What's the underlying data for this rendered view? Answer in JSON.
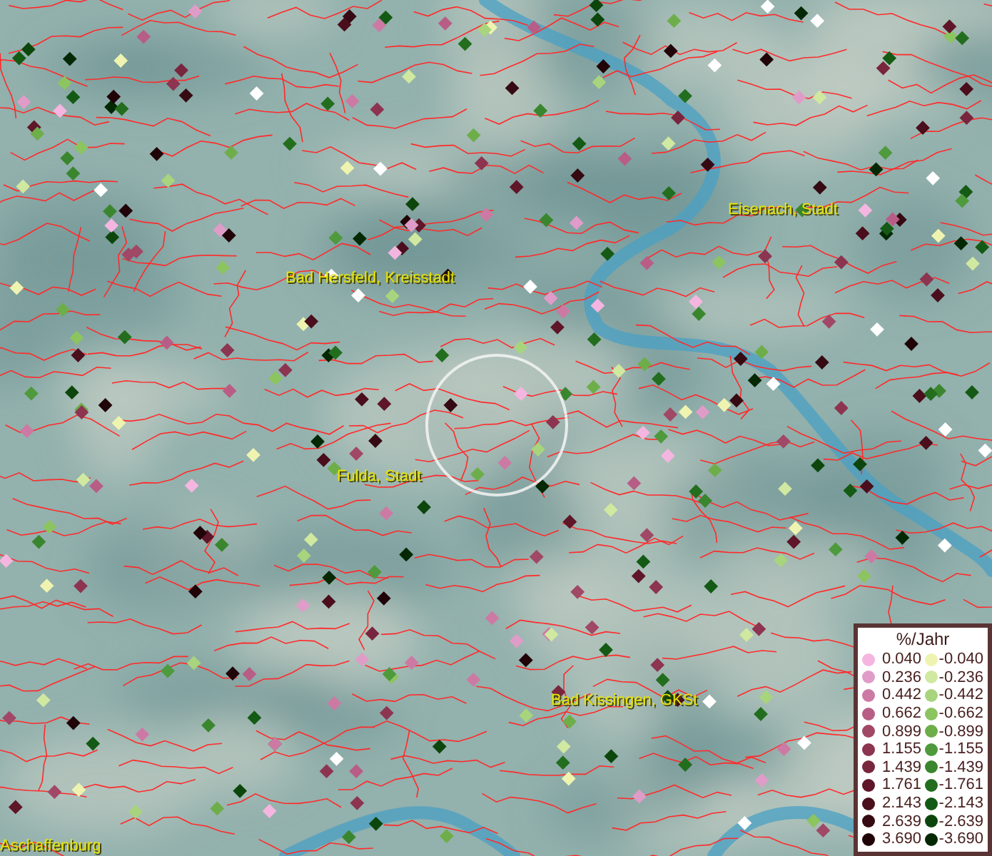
{
  "map": {
    "labels": [
      {
        "text": "Eisenach, Stadt"
      },
      {
        "text": "Bad Hersfeld, Kreisstadt"
      },
      {
        "text": "Fulda, Stadt"
      },
      {
        "text": "Bad Kissingen, GKSt"
      },
      {
        "text": "Aschaffenburg"
      }
    ]
  },
  "legend": {
    "title": "%/Jahr",
    "items": [
      {
        "value": "0.040",
        "color": "#f4b6e0"
      },
      {
        "value": "-0.040",
        "color": "#eef4b0"
      },
      {
        "value": "0.236",
        "color": "#e09cc8"
      },
      {
        "value": "-0.236",
        "color": "#d0e8a0"
      },
      {
        "value": "0.442",
        "color": "#cc7aa4"
      },
      {
        "value": "-0.442",
        "color": "#a8d47e"
      },
      {
        "value": "0.662",
        "color": "#b85e86"
      },
      {
        "value": "-0.662",
        "color": "#8cc460"
      },
      {
        "value": "0.899",
        "color": "#a04866"
      },
      {
        "value": "-0.899",
        "color": "#6eae4a"
      },
      {
        "value": "1.155",
        "color": "#8c3450"
      },
      {
        "value": "-1.155",
        "color": "#4e9a3c"
      },
      {
        "value": "1.439",
        "color": "#78263e"
      },
      {
        "value": "-1.439",
        "color": "#3a862e"
      },
      {
        "value": "1.761",
        "color": "#5e1628"
      },
      {
        "value": "-1.761",
        "color": "#226e1e"
      },
      {
        "value": "2.143",
        "color": "#4a0e1c"
      },
      {
        "value": "-2.143",
        "color": "#145a14"
      },
      {
        "value": "2.639",
        "color": "#360a12"
      },
      {
        "value": "-2.639",
        "color": "#0c460c"
      },
      {
        "value": "3.690",
        "color": "#200408"
      },
      {
        "value": "-3.690",
        "color": "#042804"
      }
    ]
  }
}
